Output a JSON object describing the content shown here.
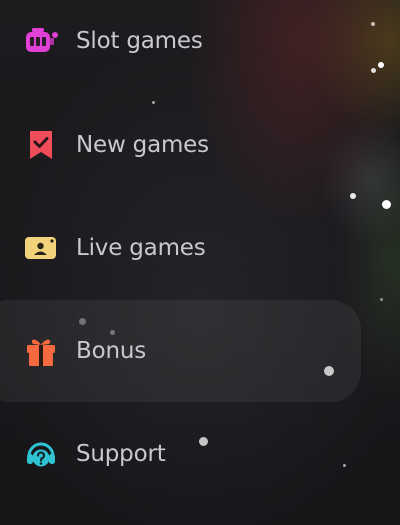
{
  "menu": {
    "items": [
      {
        "label": "Slot games",
        "icon": "slot-machine-icon",
        "active": false
      },
      {
        "label": "New games",
        "icon": "bookmark-check-icon",
        "active": false
      },
      {
        "label": "Live games",
        "icon": "live-camera-icon",
        "active": false
      },
      {
        "label": "Bonus",
        "icon": "gift-icon",
        "active": true
      },
      {
        "label": "Support",
        "icon": "headset-question-icon",
        "active": false
      }
    ]
  },
  "colors": {
    "label": "#c9c8cf",
    "slot_icon": "#e040d6",
    "new_icon": "#ef4d5a",
    "live_icon": "#f2d27a",
    "bonus_icon": "#f76a3f",
    "support_icon": "#2fc3d3",
    "active_bg": "rgba(255,255,255,0.06)",
    "background": "#1b1a1d"
  }
}
